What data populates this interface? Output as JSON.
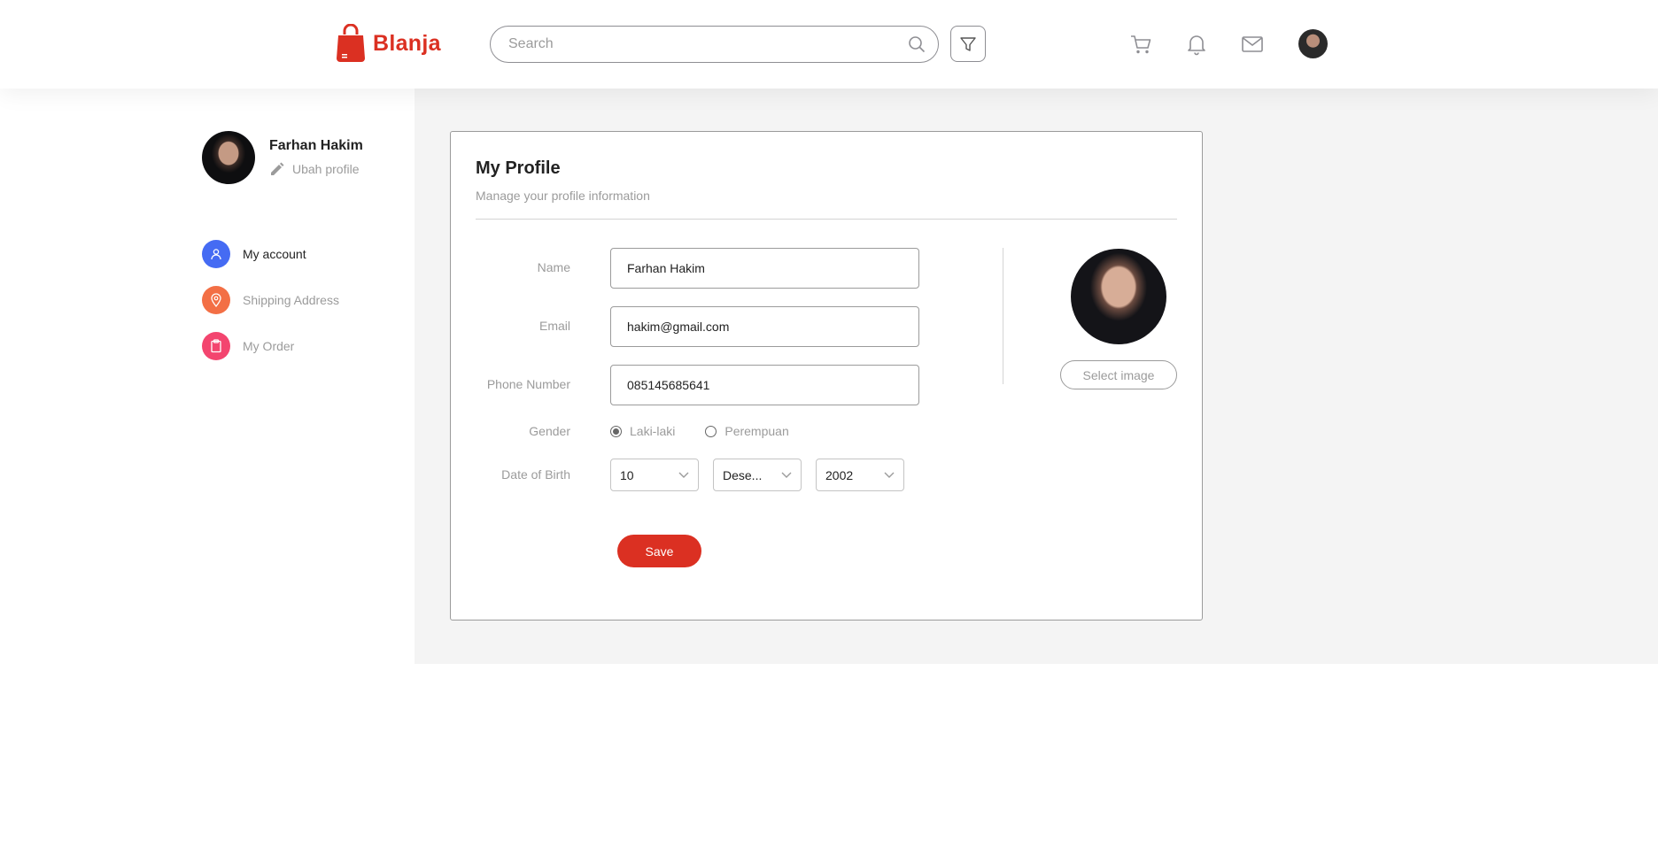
{
  "header": {
    "brand": "Blanja",
    "search_placeholder": "Search"
  },
  "sidebar": {
    "user_name": "Farhan Hakim",
    "edit_label": "Ubah profile",
    "items": [
      {
        "label": "My account",
        "icon": "person-icon",
        "color": "#456BF3",
        "active": true
      },
      {
        "label": "Shipping Address",
        "icon": "location-icon",
        "color": "#F36F45",
        "active": false
      },
      {
        "label": "My Order",
        "icon": "clipboard-icon",
        "color": "#F3456F",
        "active": false
      }
    ]
  },
  "profile": {
    "title": "My Profile",
    "subtitle": "Manage your profile information",
    "fields": {
      "name_label": "Name",
      "name_value": "Farhan Hakim",
      "email_label": "Email",
      "email_value": "hakim@gmail.com",
      "phone_label": "Phone Number",
      "phone_value": "085145685641",
      "gender_label": "Gender",
      "gender_options": [
        "Laki-laki",
        "Perempuan"
      ],
      "gender_selected": "Laki-laki",
      "dob_label": "Date of Birth",
      "dob_day": "10",
      "dob_month": "Dese...",
      "dob_year": "2002"
    },
    "save_label": "Save",
    "select_image_label": "Select image"
  },
  "colors": {
    "brand": "#DB3022",
    "muted": "#9B9B9B",
    "main_bg": "#F4F4F4"
  }
}
